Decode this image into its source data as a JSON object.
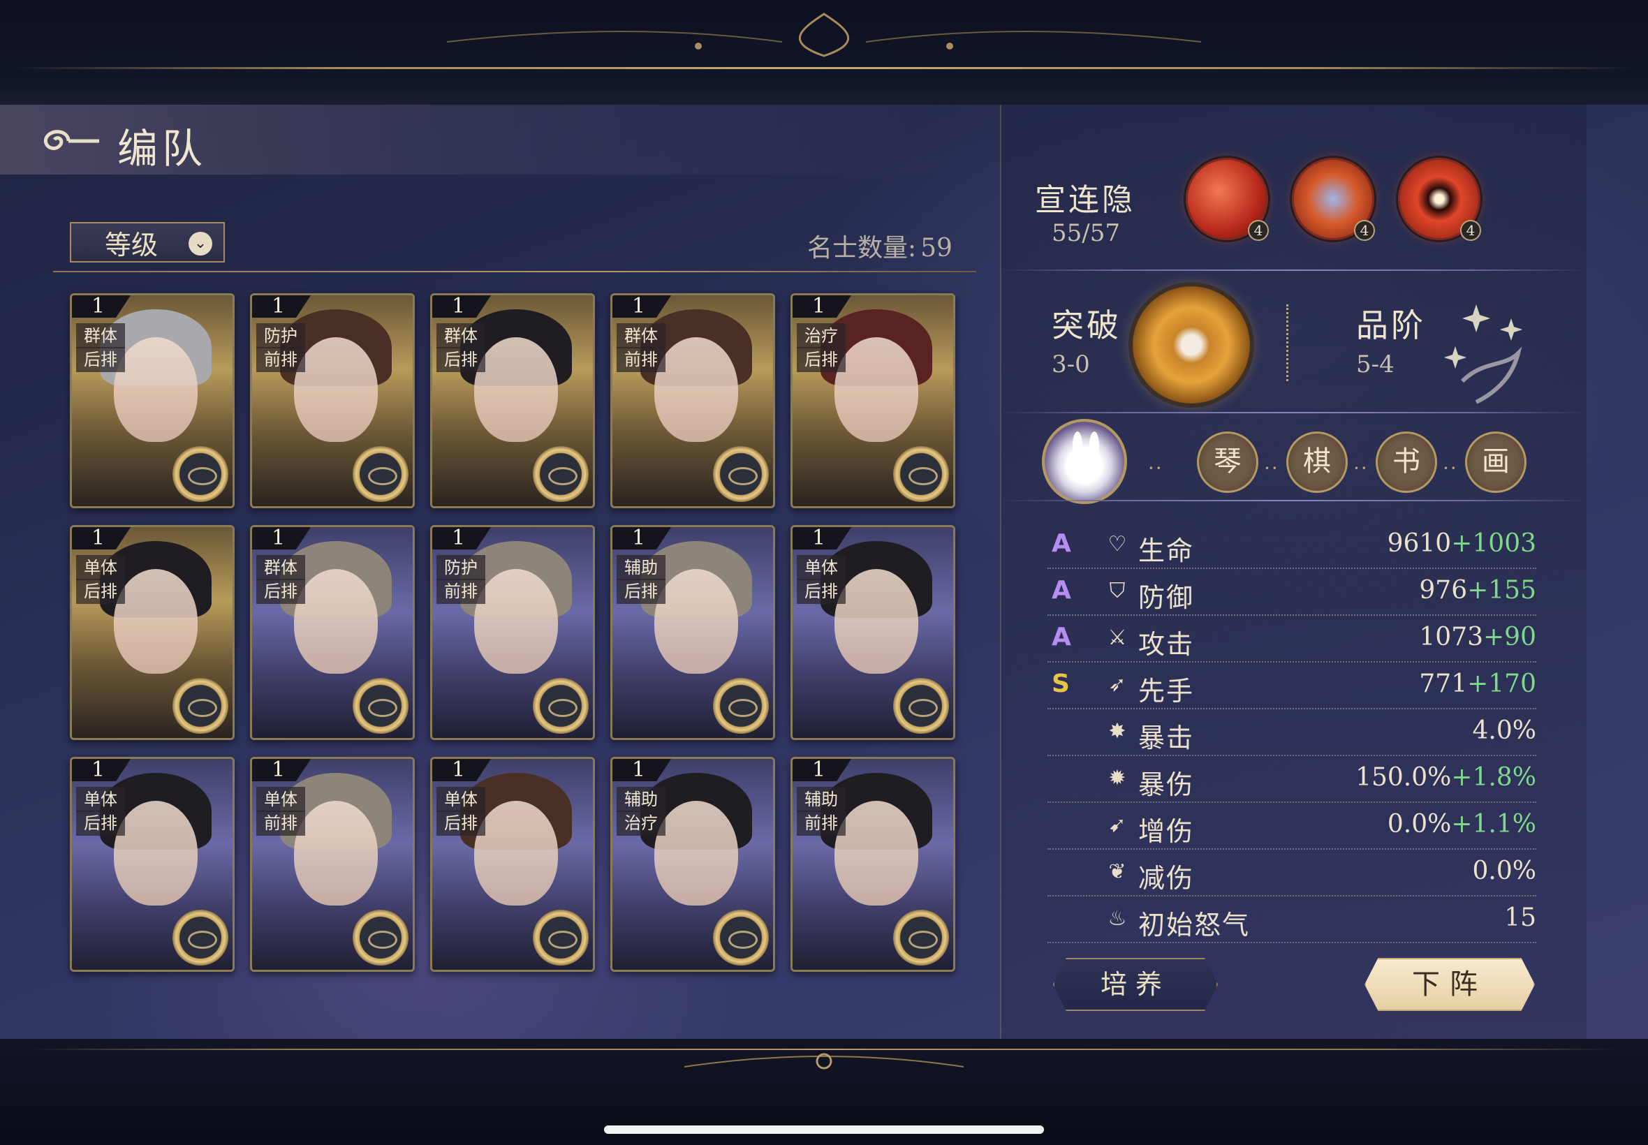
{
  "header": {
    "title": "编队"
  },
  "toolbar": {
    "sort_label": "等级",
    "count_label": "名士数量:",
    "count_value": "59"
  },
  "roster": [
    {
      "level": "1",
      "tag1": "群体",
      "tag2": "后排",
      "bg": "gold",
      "hair": "silver"
    },
    {
      "level": "1",
      "tag1": "防护",
      "tag2": "前排",
      "bg": "gold",
      "hair": "brown"
    },
    {
      "level": "1",
      "tag1": "群体",
      "tag2": "后排",
      "bg": "gold",
      "hair": "dark"
    },
    {
      "level": "1",
      "tag1": "群体",
      "tag2": "前排",
      "bg": "gold",
      "hair": "brown"
    },
    {
      "level": "1",
      "tag1": "治疗",
      "tag2": "后排",
      "bg": "gold",
      "hair": "red"
    },
    {
      "level": "1",
      "tag1": "单体",
      "tag2": "后排",
      "bg": "gold",
      "hair": "dark"
    },
    {
      "level": "1",
      "tag1": "群体",
      "tag2": "后排",
      "bg": "blue",
      "hair": "ash"
    },
    {
      "level": "1",
      "tag1": "防护",
      "tag2": "前排",
      "bg": "blue",
      "hair": "ash"
    },
    {
      "level": "1",
      "tag1": "辅助",
      "tag2": "后排",
      "bg": "blue",
      "hair": "ash"
    },
    {
      "level": "1",
      "tag1": "单体",
      "tag2": "后排",
      "bg": "blue",
      "hair": "dark"
    },
    {
      "level": "1",
      "tag1": "单体",
      "tag2": "后排",
      "bg": "blue",
      "hair": "dark"
    },
    {
      "level": "1",
      "tag1": "单体",
      "tag2": "前排",
      "bg": "blue",
      "hair": "ash"
    },
    {
      "level": "1",
      "tag1": "单体",
      "tag2": "后排",
      "bg": "blue",
      "hair": "brown"
    },
    {
      "level": "1",
      "tag1": "辅助",
      "tag2": "治疗",
      "bg": "blue",
      "hair": "dark"
    },
    {
      "level": "1",
      "tag1": "辅助",
      "tag2": "前排",
      "bg": "blue",
      "hair": "dark"
    }
  ],
  "hero": {
    "name": "宣连隐",
    "level": "55/57",
    "skills": [
      {
        "badge": "4"
      },
      {
        "badge": "4"
      },
      {
        "badge": "4"
      }
    ],
    "breakthrough_label": "突破",
    "breakthrough_value": "3-0",
    "rank_label": "品阶",
    "rank_value": "5-4",
    "bonds": [
      "琴",
      "棋",
      "书",
      "画"
    ],
    "bond_sep": "··"
  },
  "stats": [
    {
      "grade": "A",
      "icon": "heart-icon",
      "glyph": "♡",
      "name": "生命",
      "base": "9610",
      "bonus": "+1003"
    },
    {
      "grade": "A",
      "icon": "shield-icon",
      "glyph": "⛉",
      "name": "防御",
      "base": "976",
      "bonus": "+155"
    },
    {
      "grade": "A",
      "icon": "sword-icon",
      "glyph": "⚔",
      "name": "攻击",
      "base": "1073",
      "bonus": "+90"
    },
    {
      "grade": "S",
      "icon": "speed-icon",
      "glyph": "➶",
      "name": "先手",
      "base": "771",
      "bonus": "+170"
    },
    {
      "grade": "",
      "icon": "crit-icon",
      "glyph": "✸",
      "name": "暴击",
      "base": "4.0%",
      "bonus": ""
    },
    {
      "grade": "",
      "icon": "crit-damage-icon",
      "glyph": "✹",
      "name": "暴伤",
      "base": "150.0%",
      "bonus": "+1.8%"
    },
    {
      "grade": "",
      "icon": "damage-up-icon",
      "glyph": "➹",
      "name": "增伤",
      "base": "0.0%",
      "bonus": "+1.1%"
    },
    {
      "grade": "",
      "icon": "damage-reduce-icon",
      "glyph": "❦",
      "name": "减伤",
      "base": "0.0%",
      "bonus": ""
    },
    {
      "grade": "",
      "icon": "rage-icon",
      "glyph": "♨",
      "name": "初始怒气",
      "base": "15",
      "bonus": ""
    }
  ],
  "actions": {
    "train_label": "培养",
    "remove_label": "下阵"
  },
  "colors": {
    "grade_a": "#b58ef2",
    "grade_s": "#e6c24a",
    "bonus": "#7fd98a",
    "gold": "#b89a66"
  }
}
